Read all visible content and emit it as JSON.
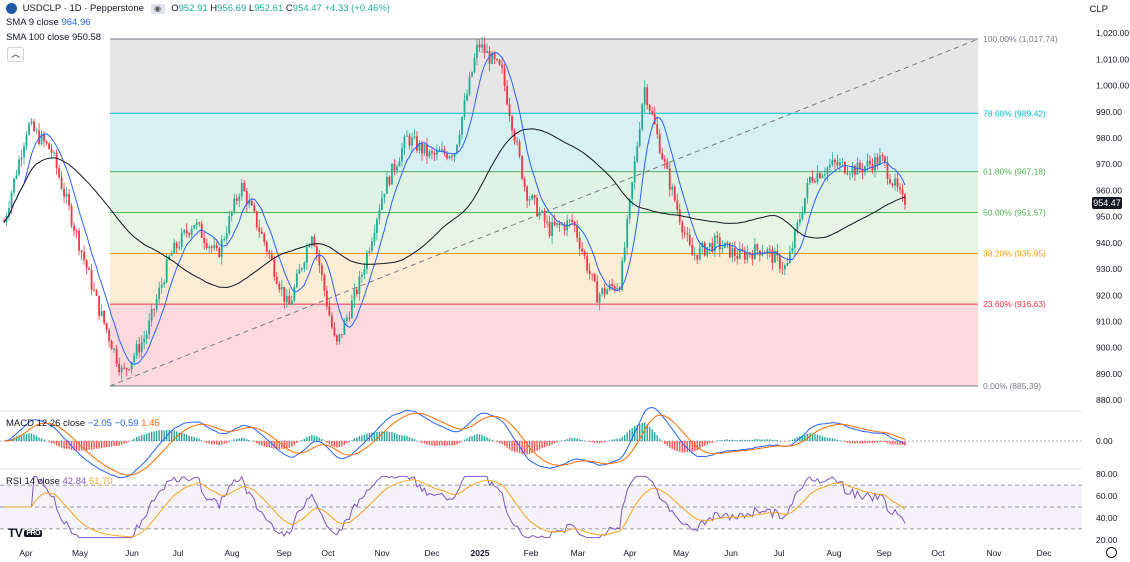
{
  "header": {
    "symbol_line": "USDCLP · 1D · Pepperstone",
    "open_label": "O",
    "open": "952.91",
    "high_label": "H",
    "high": "956.69",
    "low_label": "L",
    "low": "952.61",
    "close_label": "C",
    "close": "954.47",
    "change": "+4.33 (+0.46%)",
    "currency": "CLP",
    "collapse_icon": "chevron-up-icon"
  },
  "indicators": {
    "sma9_label": "SMA 9 close",
    "sma9_value": "964.96",
    "sma100_label": "SMA 100 close",
    "sma100_value": "950.58",
    "macd_label": "MACD 12 26 close",
    "macd_v1": "−2.05",
    "macd_v2": "−0.59",
    "macd_v3": "1.45",
    "rsi_label": "RSI 14 close",
    "rsi_v1": "42.84",
    "rsi_v2": "51.70"
  },
  "current_price_tag": "954.47",
  "logo_text": "TV",
  "logo_badge": "PRO",
  "settings_icon": "gear-icon",
  "colors": {
    "up": "#22ab94",
    "down": "#f23645",
    "sma9": "#2962ff",
    "sma100": "#131722",
    "macd_line": "#2962ff",
    "signal_line": "#ff6d00",
    "rsi_line": "#7e57c2",
    "rsi_ma": "#f5a623"
  },
  "chart_data": [
    {
      "type": "candlestick",
      "title": "USDCLP · 1D · Pepperstone",
      "x_axis_labels": [
        "Apr",
        "May",
        "Jun",
        "Jul",
        "Aug",
        "Sep",
        "Oct",
        "Nov",
        "Dec",
        "2025",
        "Feb",
        "Mar",
        "Apr",
        "May",
        "Jun",
        "Jul",
        "Aug",
        "Sep",
        "Oct",
        "Nov",
        "Dec"
      ],
      "y_ticks": [
        880,
        890,
        900,
        910,
        920,
        930,
        940,
        950,
        960,
        970,
        980,
        990,
        1000,
        1010,
        1020
      ],
      "y_tick_labels": [
        "880.00",
        "890.00",
        "900.00",
        "910.00",
        "920.00",
        "930.00",
        "940.00",
        "950.00",
        "960.00",
        "970.00",
        "980.00",
        "990.00",
        "1,000.00",
        "1,010.00",
        "1,020.00"
      ],
      "ylim": [
        877,
        1025
      ],
      "price_anchors": [
        {
          "month": "Apr",
          "value": 948
        },
        {
          "month": "Apr",
          "value": 985
        },
        {
          "month": "Apr",
          "value": 975
        },
        {
          "month": "May",
          "value": 945
        },
        {
          "month": "May",
          "value": 915
        },
        {
          "month": "May",
          "value": 890
        },
        {
          "month": "Jun",
          "value": 905
        },
        {
          "month": "Jun",
          "value": 935
        },
        {
          "month": "Jul",
          "value": 948
        },
        {
          "month": "Jul",
          "value": 935
        },
        {
          "month": "Aug",
          "value": 962
        },
        {
          "month": "Aug",
          "value": 940
        },
        {
          "month": "Sep",
          "value": 915
        },
        {
          "month": "Sep",
          "value": 945
        },
        {
          "month": "Oct",
          "value": 900
        },
        {
          "month": "Oct",
          "value": 925
        },
        {
          "month": "Nov",
          "value": 960
        },
        {
          "month": "Nov",
          "value": 980
        },
        {
          "month": "Dec",
          "value": 973
        },
        {
          "month": "Dec",
          "value": 975
        },
        {
          "month": "2025",
          "value": 1016
        },
        {
          "month": "2025",
          "value": 1005
        },
        {
          "month": "Feb",
          "value": 960
        },
        {
          "month": "Feb",
          "value": 945
        },
        {
          "month": "Mar",
          "value": 948
        },
        {
          "month": "Mar",
          "value": 920
        },
        {
          "month": "Apr",
          "value": 925
        },
        {
          "month": "Apr",
          "value": 1000
        },
        {
          "month": "Apr",
          "value": 965
        },
        {
          "month": "May",
          "value": 935
        },
        {
          "month": "May",
          "value": 940
        },
        {
          "month": "Jun",
          "value": 935
        },
        {
          "month": "Jun",
          "value": 938
        },
        {
          "month": "Jul",
          "value": 930
        },
        {
          "month": "Jul",
          "value": 965
        },
        {
          "month": "Aug",
          "value": 970
        },
        {
          "month": "Aug",
          "value": 968
        },
        {
          "month": "Sep",
          "value": 972
        },
        {
          "month": "Sep",
          "value": 954
        }
      ],
      "series": [
        {
          "name": "SMA 9 close",
          "last": 964.96
        },
        {
          "name": "SMA 100 close",
          "last": 950.58
        }
      ],
      "fibonacci": [
        {
          "ratio": "100.00%",
          "value": 1017.74,
          "label": "100.00% (1,017.74)",
          "color": "#787b86"
        },
        {
          "ratio": "78.60%",
          "value": 989.42,
          "label": "78.60% (989.42)",
          "color": "#00bcd4"
        },
        {
          "ratio": "61.80%",
          "value": 967.18,
          "label": "61.80% (967.18)",
          "color": "#4caf50"
        },
        {
          "ratio": "50.00%",
          "value": 951.57,
          "label": "50.00% (951.57)",
          "color": "#4caf50"
        },
        {
          "ratio": "38.20%",
          "value": 935.95,
          "label": "38.20% (935.95)",
          "color": "#ff9800"
        },
        {
          "ratio": "23.60%",
          "value": 916.63,
          "label": "23.60% (916.63)",
          "color": "#f23645"
        },
        {
          "ratio": "0.00%",
          "value": 885.39,
          "label": "0.00% (885.39)",
          "color": "#787b86"
        }
      ],
      "last_price": 954.47
    },
    {
      "type": "line",
      "title": "MACD 12 26 close",
      "y_ticks": [
        0
      ],
      "y_tick_labels": [
        "0.00"
      ],
      "ylim": [
        -12,
        12
      ],
      "series": [
        {
          "name": "MACD",
          "last": -2.05
        },
        {
          "name": "Signal",
          "last": -0.59
        },
        {
          "name": "Histogram",
          "last": 1.45
        }
      ]
    },
    {
      "type": "line",
      "title": "RSI 14 close",
      "y_ticks": [
        20,
        40,
        60,
        80
      ],
      "y_tick_labels": [
        "20.00",
        "40.00",
        "60.00",
        "80.00"
      ],
      "ylim": [
        18,
        82
      ],
      "bands": [
        30,
        50,
        70
      ],
      "series": [
        {
          "name": "RSI",
          "last": 42.84
        },
        {
          "name": "RSI MA",
          "last": 51.7
        }
      ]
    }
  ]
}
